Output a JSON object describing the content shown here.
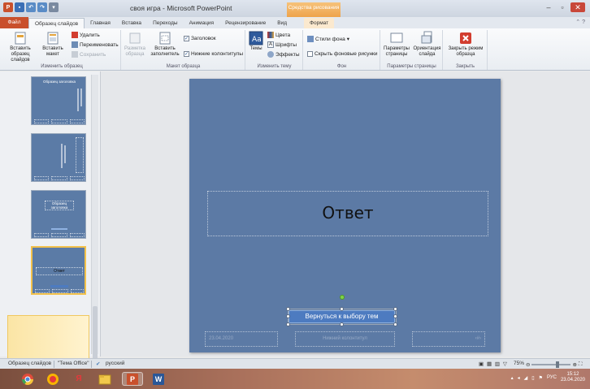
{
  "window": {
    "title": "своя игра - Microsoft PowerPoint",
    "context_tab_group": "Средства рисования"
  },
  "tabs": [
    {
      "label": "Файл"
    },
    {
      "label": "Образец слайдов"
    },
    {
      "label": "Главная"
    },
    {
      "label": "Вставка"
    },
    {
      "label": "Переходы"
    },
    {
      "label": "Анимация"
    },
    {
      "label": "Рецензирование"
    },
    {
      "label": "Вид"
    },
    {
      "label": "Формат"
    }
  ],
  "ribbon": {
    "edit_master": {
      "group_label": "Изменить образец",
      "insert_master": "Вставить образец слайдов",
      "insert_layout": "Вставить макет",
      "delete": "Удалить",
      "rename": "Переименовать",
      "preserve": "Сохранить"
    },
    "master_layout": {
      "group_label": "Макет образца",
      "layout_master": "Разметка образца",
      "insert_placeholder": "Вставить заполнитель",
      "title_check": "Заголовок",
      "footers_check": "Нижние колонтитулы"
    },
    "edit_theme": {
      "group_label": "Изменить тему",
      "themes": "Темы",
      "colors": "Цвета",
      "fonts": "Шрифты",
      "effects": "Эффекты"
    },
    "background": {
      "group_label": "Фон",
      "styles": "Стили фона",
      "hide_graphics": "Скрыть фоновые рисунки"
    },
    "page_setup": {
      "group_label": "Параметры страницы",
      "page_setup": "Параметры страницы",
      "orientation": "Ориентация слайда"
    },
    "close": {
      "group_label": "Закрыть",
      "close_master": "Закрыть режим образца"
    }
  },
  "thumbnails": [
    {
      "title": "Образец заголовка"
    },
    {
      "title": ""
    },
    {
      "title": "Образец заголовка"
    },
    {
      "title": "Ответ"
    }
  ],
  "slide": {
    "title": "Ответ",
    "button_text": "Вернуться к выбору тем",
    "footer_date": "23.04.2020",
    "footer_text": "Нижний колонтитул",
    "footer_number": "‹#›"
  },
  "statusbar": {
    "view": "Образец слайдов",
    "theme": "\"Тема Office\"",
    "language": "русский",
    "zoom": "75%"
  },
  "taskbar": {
    "lang": "РУС",
    "time": "15:12",
    "date": "23.04.2020"
  },
  "colors": {
    "slide_bg": "#5c7aa5",
    "file_tab": "#c9502c",
    "context_tab": "#eea34a"
  }
}
